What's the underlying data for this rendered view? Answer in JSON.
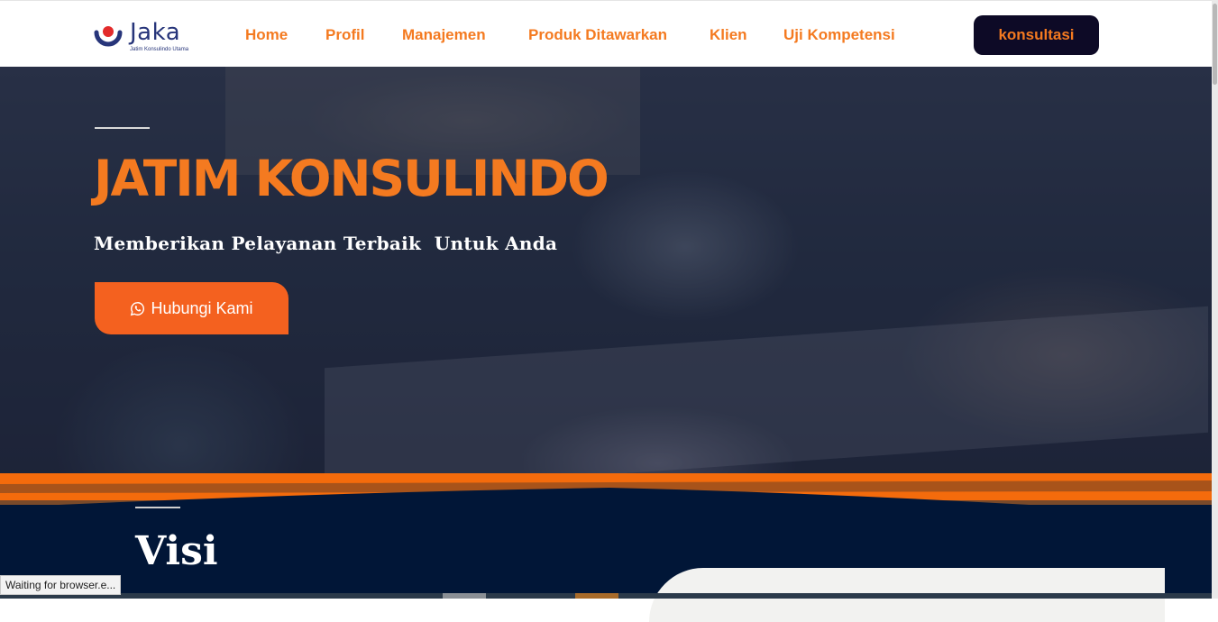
{
  "header": {
    "logo_text": "Jaka",
    "logo_subtitle": "Jatim Konsulindo Utama",
    "nav": [
      {
        "label": "Home"
      },
      {
        "label": "Profil"
      },
      {
        "label": "Manajemen"
      },
      {
        "label": "Produk Ditawarkan"
      },
      {
        "label": "Klien"
      },
      {
        "label": "Uji Kompetensi"
      }
    ],
    "cta_label": "konsultasi"
  },
  "hero": {
    "title": "JATIM KONSULINDO",
    "subtitle": "Memberikan Pelayanan Terbaik  Untuk Anda",
    "button_label": "Hubungi Kami",
    "button_icon": "whatsapp-icon"
  },
  "visi": {
    "title": "Visi"
  },
  "status_bar": {
    "text": "Waiting for browser.e..."
  },
  "colors": {
    "accent": "#f47a20",
    "navy": "#011637",
    "cta_bg": "#0d0a26",
    "button_orange": "#f4611f",
    "logo_blue": "#27357a",
    "logo_red": "#e32b2b"
  }
}
